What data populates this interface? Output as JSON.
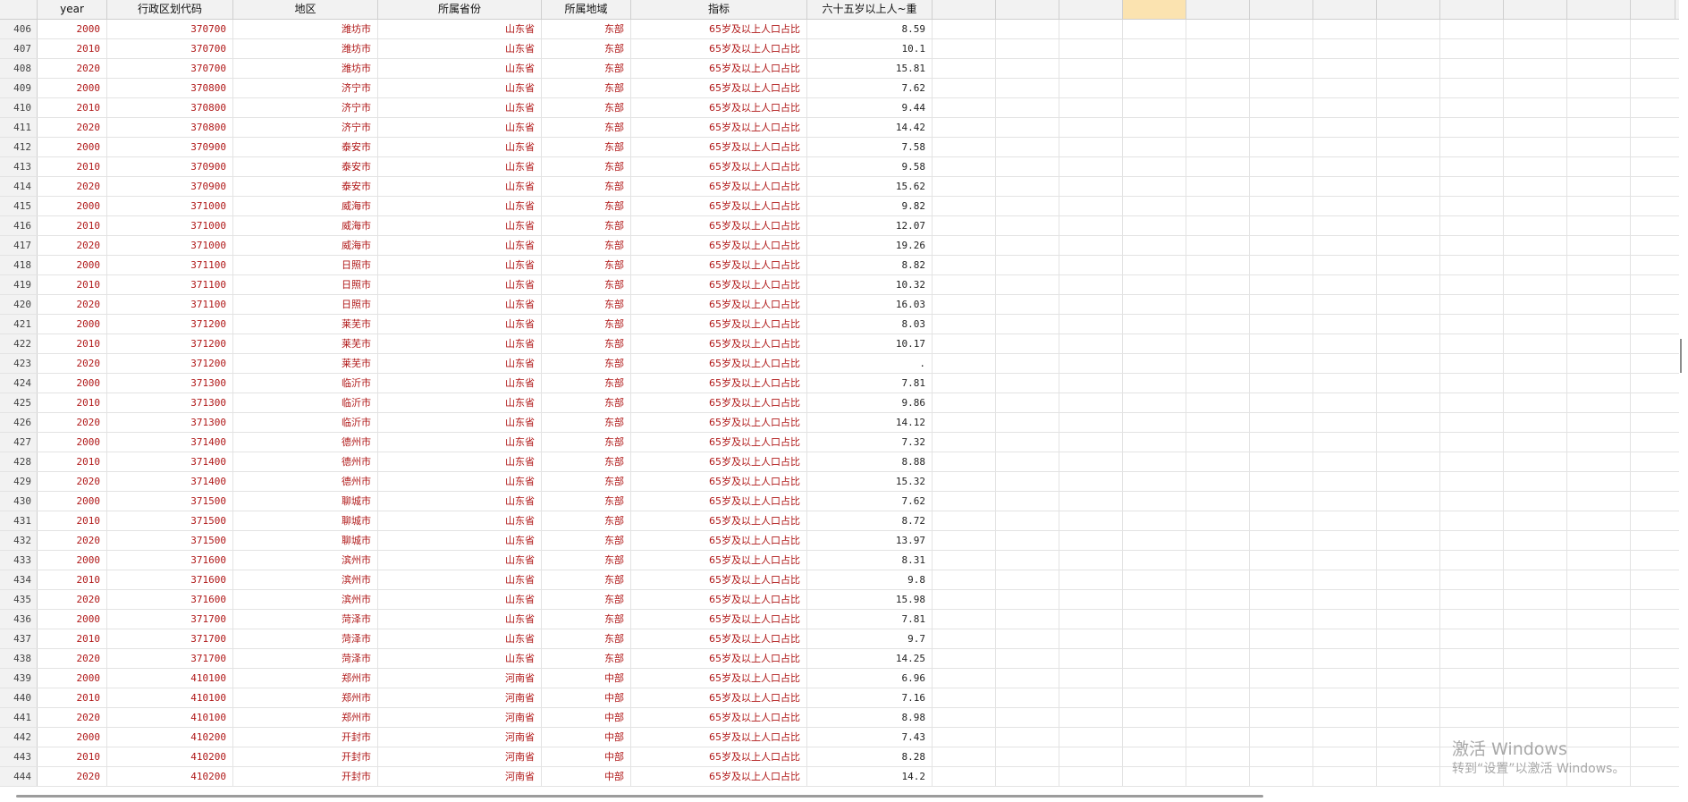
{
  "columns": [
    "year",
    "行政区划代码",
    "地区",
    "所属省份",
    "所属地域",
    "指标",
    "六十五岁以上人~重",
    "",
    "",
    "",
    "",
    "",
    "",
    "",
    "",
    "",
    "",
    "",
    ""
  ],
  "rows": [
    {
      "n": "406",
      "year": "2000",
      "code": "370700",
      "area": "潍坊市",
      "prov": "山东省",
      "region": "东部",
      "ind": "65岁及以上人口占比",
      "val": "8.59"
    },
    {
      "n": "407",
      "year": "2010",
      "code": "370700",
      "area": "潍坊市",
      "prov": "山东省",
      "region": "东部",
      "ind": "65岁及以上人口占比",
      "val": "10.1"
    },
    {
      "n": "408",
      "year": "2020",
      "code": "370700",
      "area": "潍坊市",
      "prov": "山东省",
      "region": "东部",
      "ind": "65岁及以上人口占比",
      "val": "15.81"
    },
    {
      "n": "409",
      "year": "2000",
      "code": "370800",
      "area": "济宁市",
      "prov": "山东省",
      "region": "东部",
      "ind": "65岁及以上人口占比",
      "val": "7.62"
    },
    {
      "n": "410",
      "year": "2010",
      "code": "370800",
      "area": "济宁市",
      "prov": "山东省",
      "region": "东部",
      "ind": "65岁及以上人口占比",
      "val": "9.44"
    },
    {
      "n": "411",
      "year": "2020",
      "code": "370800",
      "area": "济宁市",
      "prov": "山东省",
      "region": "东部",
      "ind": "65岁及以上人口占比",
      "val": "14.42"
    },
    {
      "n": "412",
      "year": "2000",
      "code": "370900",
      "area": "泰安市",
      "prov": "山东省",
      "region": "东部",
      "ind": "65岁及以上人口占比",
      "val": "7.58"
    },
    {
      "n": "413",
      "year": "2010",
      "code": "370900",
      "area": "泰安市",
      "prov": "山东省",
      "region": "东部",
      "ind": "65岁及以上人口占比",
      "val": "9.58"
    },
    {
      "n": "414",
      "year": "2020",
      "code": "370900",
      "area": "泰安市",
      "prov": "山东省",
      "region": "东部",
      "ind": "65岁及以上人口占比",
      "val": "15.62"
    },
    {
      "n": "415",
      "year": "2000",
      "code": "371000",
      "area": "威海市",
      "prov": "山东省",
      "region": "东部",
      "ind": "65岁及以上人口占比",
      "val": "9.82"
    },
    {
      "n": "416",
      "year": "2010",
      "code": "371000",
      "area": "威海市",
      "prov": "山东省",
      "region": "东部",
      "ind": "65岁及以上人口占比",
      "val": "12.07"
    },
    {
      "n": "417",
      "year": "2020",
      "code": "371000",
      "area": "威海市",
      "prov": "山东省",
      "region": "东部",
      "ind": "65岁及以上人口占比",
      "val": "19.26"
    },
    {
      "n": "418",
      "year": "2000",
      "code": "371100",
      "area": "日照市",
      "prov": "山东省",
      "region": "东部",
      "ind": "65岁及以上人口占比",
      "val": "8.82"
    },
    {
      "n": "419",
      "year": "2010",
      "code": "371100",
      "area": "日照市",
      "prov": "山东省",
      "region": "东部",
      "ind": "65岁及以上人口占比",
      "val": "10.32"
    },
    {
      "n": "420",
      "year": "2020",
      "code": "371100",
      "area": "日照市",
      "prov": "山东省",
      "region": "东部",
      "ind": "65岁及以上人口占比",
      "val": "16.03"
    },
    {
      "n": "421",
      "year": "2000",
      "code": "371200",
      "area": "莱芜市",
      "prov": "山东省",
      "region": "东部",
      "ind": "65岁及以上人口占比",
      "val": "8.03"
    },
    {
      "n": "422",
      "year": "2010",
      "code": "371200",
      "area": "莱芜市",
      "prov": "山东省",
      "region": "东部",
      "ind": "65岁及以上人口占比",
      "val": "10.17"
    },
    {
      "n": "423",
      "year": "2020",
      "code": "371200",
      "area": "莱芜市",
      "prov": "山东省",
      "region": "东部",
      "ind": "65岁及以上人口占比",
      "val": "."
    },
    {
      "n": "424",
      "year": "2000",
      "code": "371300",
      "area": "临沂市",
      "prov": "山东省",
      "region": "东部",
      "ind": "65岁及以上人口占比",
      "val": "7.81"
    },
    {
      "n": "425",
      "year": "2010",
      "code": "371300",
      "area": "临沂市",
      "prov": "山东省",
      "region": "东部",
      "ind": "65岁及以上人口占比",
      "val": "9.86"
    },
    {
      "n": "426",
      "year": "2020",
      "code": "371300",
      "area": "临沂市",
      "prov": "山东省",
      "region": "东部",
      "ind": "65岁及以上人口占比",
      "val": "14.12"
    },
    {
      "n": "427",
      "year": "2000",
      "code": "371400",
      "area": "德州市",
      "prov": "山东省",
      "region": "东部",
      "ind": "65岁及以上人口占比",
      "val": "7.32"
    },
    {
      "n": "428",
      "year": "2010",
      "code": "371400",
      "area": "德州市",
      "prov": "山东省",
      "region": "东部",
      "ind": "65岁及以上人口占比",
      "val": "8.88"
    },
    {
      "n": "429",
      "year": "2020",
      "code": "371400",
      "area": "德州市",
      "prov": "山东省",
      "region": "东部",
      "ind": "65岁及以上人口占比",
      "val": "15.32"
    },
    {
      "n": "430",
      "year": "2000",
      "code": "371500",
      "area": "聊城市",
      "prov": "山东省",
      "region": "东部",
      "ind": "65岁及以上人口占比",
      "val": "7.62"
    },
    {
      "n": "431",
      "year": "2010",
      "code": "371500",
      "area": "聊城市",
      "prov": "山东省",
      "region": "东部",
      "ind": "65岁及以上人口占比",
      "val": "8.72"
    },
    {
      "n": "432",
      "year": "2020",
      "code": "371500",
      "area": "聊城市",
      "prov": "山东省",
      "region": "东部",
      "ind": "65岁及以上人口占比",
      "val": "13.97"
    },
    {
      "n": "433",
      "year": "2000",
      "code": "371600",
      "area": "滨州市",
      "prov": "山东省",
      "region": "东部",
      "ind": "65岁及以上人口占比",
      "val": "8.31"
    },
    {
      "n": "434",
      "year": "2010",
      "code": "371600",
      "area": "滨州市",
      "prov": "山东省",
      "region": "东部",
      "ind": "65岁及以上人口占比",
      "val": "9.8"
    },
    {
      "n": "435",
      "year": "2020",
      "code": "371600",
      "area": "滨州市",
      "prov": "山东省",
      "region": "东部",
      "ind": "65岁及以上人口占比",
      "val": "15.98"
    },
    {
      "n": "436",
      "year": "2000",
      "code": "371700",
      "area": "菏泽市",
      "prov": "山东省",
      "region": "东部",
      "ind": "65岁及以上人口占比",
      "val": "7.81"
    },
    {
      "n": "437",
      "year": "2010",
      "code": "371700",
      "area": "菏泽市",
      "prov": "山东省",
      "region": "东部",
      "ind": "65岁及以上人口占比",
      "val": "9.7"
    },
    {
      "n": "438",
      "year": "2020",
      "code": "371700",
      "area": "菏泽市",
      "prov": "山东省",
      "region": "东部",
      "ind": "65岁及以上人口占比",
      "val": "14.25"
    },
    {
      "n": "439",
      "year": "2000",
      "code": "410100",
      "area": "郑州市",
      "prov": "河南省",
      "region": "中部",
      "ind": "65岁及以上人口占比",
      "val": "6.96"
    },
    {
      "n": "440",
      "year": "2010",
      "code": "410100",
      "area": "郑州市",
      "prov": "河南省",
      "region": "中部",
      "ind": "65岁及以上人口占比",
      "val": "7.16"
    },
    {
      "n": "441",
      "year": "2020",
      "code": "410100",
      "area": "郑州市",
      "prov": "河南省",
      "region": "中部",
      "ind": "65岁及以上人口占比",
      "val": "8.98"
    },
    {
      "n": "442",
      "year": "2000",
      "code": "410200",
      "area": "开封市",
      "prov": "河南省",
      "region": "中部",
      "ind": "65岁及以上人口占比",
      "val": "7.43"
    },
    {
      "n": "443",
      "year": "2010",
      "code": "410200",
      "area": "开封市",
      "prov": "河南省",
      "region": "中部",
      "ind": "65岁及以上人口占比",
      "val": "8.28"
    },
    {
      "n": "444",
      "year": "2020",
      "code": "410200",
      "area": "开封市",
      "prov": "河南省",
      "region": "中部",
      "ind": "65岁及以上人口占比",
      "val": "14.2"
    }
  ],
  "watermark": {
    "title": "激活 Windows",
    "subtitle": "转到“设置”以激活 Windows。"
  },
  "colors": {
    "cell_text": "#b01818",
    "value_text": "#222222",
    "header_bg": "#f2f2f2",
    "selected_header": "#fbe3b0"
  }
}
